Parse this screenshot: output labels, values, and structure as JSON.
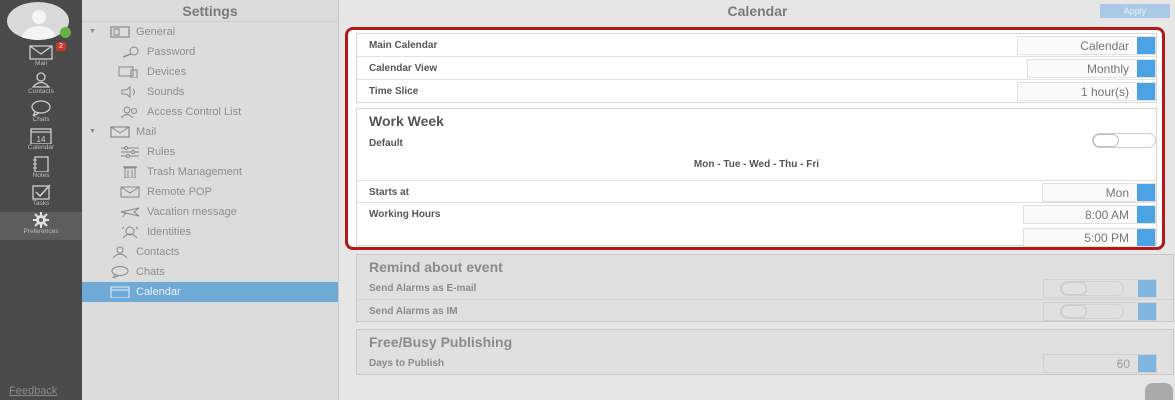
{
  "rail": {
    "items": [
      {
        "label": "Mail",
        "icon": "mail-icon",
        "badge": "2"
      },
      {
        "label": "Contacts",
        "icon": "contacts-icon"
      },
      {
        "label": "Chats",
        "icon": "chats-icon"
      },
      {
        "label": "Calendar",
        "icon": "calendar-icon",
        "day": "14"
      },
      {
        "label": "Notes",
        "icon": "notes-icon"
      },
      {
        "label": "Tasks",
        "icon": "tasks-icon"
      },
      {
        "label": "Preferences",
        "icon": "gear-icon"
      }
    ],
    "feedback": "Feedback"
  },
  "settings": {
    "title": "Settings",
    "nav": [
      {
        "label": "General",
        "icon": "general-icon",
        "expanded": true
      },
      {
        "label": "Password",
        "icon": "key-icon"
      },
      {
        "label": "Devices",
        "icon": "devices-icon"
      },
      {
        "label": "Sounds",
        "icon": "speaker-icon"
      },
      {
        "label": "Access Control List",
        "icon": "users-icon"
      },
      {
        "label": "Mail",
        "icon": "mail-icon",
        "expanded": true
      },
      {
        "label": "Rules",
        "icon": "sliders-icon"
      },
      {
        "label": "Trash Management",
        "icon": "trash-icon"
      },
      {
        "label": "Remote POP",
        "icon": "envelope-icon"
      },
      {
        "label": "Vacation message",
        "icon": "plane-icon"
      },
      {
        "label": "Identities",
        "icon": "identities-icon"
      },
      {
        "label": "Contacts",
        "icon": "contacts-icon"
      },
      {
        "label": "Chats",
        "icon": "chats-icon"
      },
      {
        "label": "Calendar",
        "icon": "calendar-icon",
        "selected": true
      }
    ]
  },
  "main": {
    "title": "Calendar",
    "apply_label": "Apply",
    "calendar": {
      "main_calendar_label": "Main Calendar",
      "main_calendar_value": "Calendar",
      "calendar_view_label": "Calendar View",
      "calendar_view_value": "Monthly",
      "time_slice_label": "Time Slice",
      "time_slice_value": "1 hour(s)"
    },
    "work_week": {
      "title": "Work Week",
      "default_label": "Default",
      "default_on": false,
      "days": "Mon - Tue - Wed - Thu - Fri",
      "starts_at_label": "Starts at",
      "starts_at_value": "Mon",
      "working_hours_label": "Working Hours",
      "working_hours_start": "8:00 AM",
      "working_hours_end": "5:00 PM"
    },
    "remind": {
      "title": "Remind about event",
      "email_label": "Send Alarms as E-mail",
      "im_label": "Send Alarms as IM"
    },
    "free_busy": {
      "title": "Free/Busy Publishing",
      "days_label": "Days to Publish",
      "days_value": "60"
    }
  },
  "colors": {
    "accent": "#4ba3e3",
    "highlight_border": "#b01a1a",
    "selected_nav": "#6fa9d6",
    "rail": "#4a4a4a"
  }
}
